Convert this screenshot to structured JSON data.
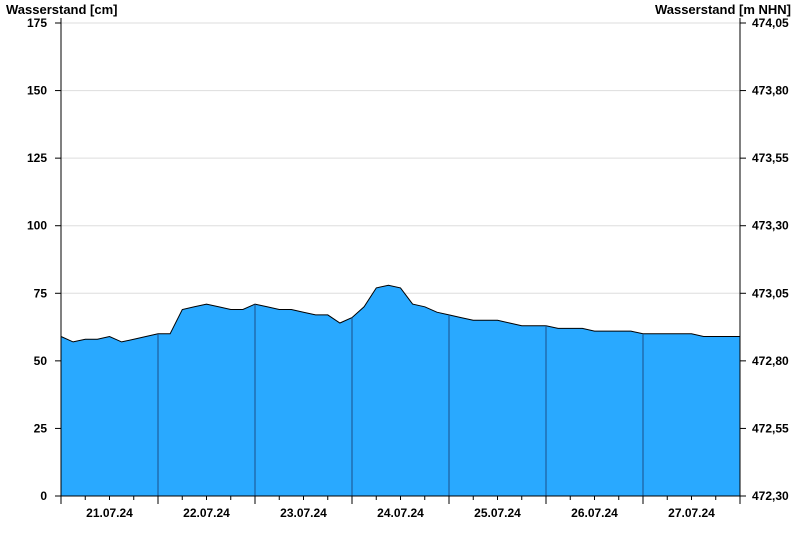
{
  "chart_data": {
    "type": "area",
    "ylabel_left": "Wasserstand [cm]",
    "ylabel_right": "Wasserstand [m NHN]",
    "ylim": [
      0,
      175
    ],
    "yticks_left": [
      "0",
      "25",
      "50",
      "75",
      "100",
      "125",
      "150",
      "175"
    ],
    "yticks_right": [
      "472,30",
      "472,55",
      "472,80",
      "473,05",
      "473,30",
      "473,55",
      "473,80",
      "474,05"
    ],
    "x_day_labels": [
      "21.07.24",
      "22.07.24",
      "23.07.24",
      "24.07.24",
      "25.07.24",
      "26.07.24",
      "27.07.24"
    ],
    "x_hours": [
      0,
      3,
      6,
      9,
      12,
      15,
      18,
      21,
      24,
      27,
      30,
      33,
      36,
      39,
      42,
      45,
      48,
      51,
      54,
      57,
      60,
      63,
      66,
      69,
      72,
      75,
      78,
      81,
      84,
      87,
      90,
      93,
      96,
      99,
      102,
      105,
      108,
      111,
      114,
      117,
      120,
      123,
      126,
      129,
      132,
      135,
      138,
      141,
      144,
      147,
      150,
      153,
      156,
      159,
      162,
      165,
      168
    ],
    "y_cm": [
      59,
      57,
      58,
      58,
      59,
      57,
      58,
      59,
      60,
      60,
      69,
      70,
      71,
      70,
      69,
      69,
      71,
      70,
      69,
      69,
      68,
      67,
      67,
      64,
      66,
      70,
      77,
      78,
      77,
      71,
      70,
      68,
      67,
      66,
      65,
      65,
      65,
      64,
      63,
      63,
      63,
      62,
      62,
      62,
      61,
      61,
      61,
      61,
      60,
      60,
      60,
      60,
      60,
      59,
      59,
      59,
      59
    ],
    "fill_color": "#29a9ff",
    "line_color": "#000000",
    "day_separator_color": "#1b4f8a",
    "grid_color": "#dddddd",
    "grid": true
  }
}
